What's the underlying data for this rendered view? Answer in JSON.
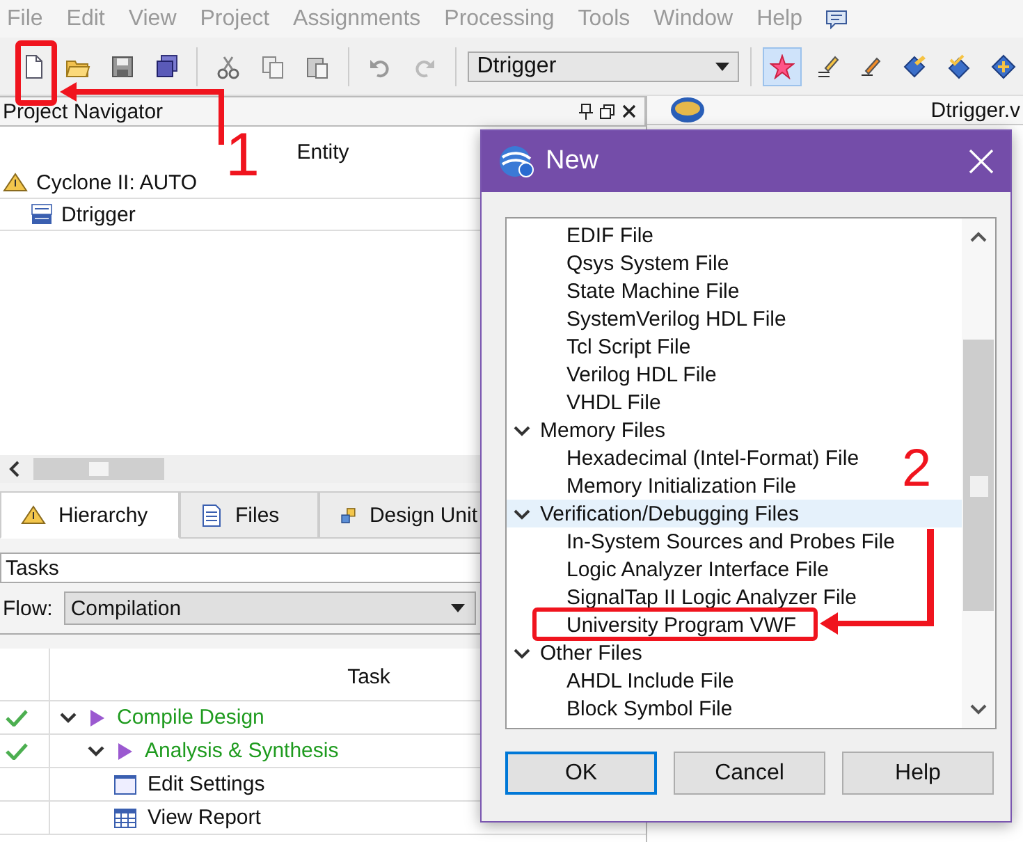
{
  "menu": [
    "File",
    "Edit",
    "View",
    "Project",
    "Assignments",
    "Processing",
    "Tools",
    "Window",
    "Help"
  ],
  "toolbar": {
    "entity_dropdown": "Dtrigger"
  },
  "project_navigator": {
    "title": "Project Navigator",
    "column": "Entity",
    "tree": [
      {
        "label": "Cyclone II: AUTO",
        "kind": "device",
        "children": [
          {
            "label": "Dtrigger",
            "kind": "entity"
          }
        ]
      }
    ]
  },
  "tabs": [
    {
      "label": "Hierarchy",
      "selected": true
    },
    {
      "label": "Files",
      "selected": false
    },
    {
      "label": "Design Unit",
      "selected": false
    }
  ],
  "tasks": {
    "title": "Tasks",
    "flow_label": "Flow:",
    "flow": "Compilation",
    "column": "Task",
    "rows": [
      {
        "label": "Compile Design",
        "kind": "flow",
        "completed": true,
        "expanded": true,
        "children": [
          {
            "label": "Analysis & Synthesis",
            "kind": "flow",
            "completed": true,
            "expanded": true,
            "children": [
              {
                "label": "Edit Settings",
                "kind": "settings",
                "completed": false
              },
              {
                "label": "View Report",
                "kind": "report",
                "completed": false
              }
            ]
          }
        ]
      }
    ]
  },
  "editor": {
    "tab": "Dtrigger.v"
  },
  "dialog": {
    "title": "New",
    "orphan_items": [
      {
        "label": "EDIF File",
        "selected": false
      },
      {
        "label": "Qsys System File",
        "selected": false
      },
      {
        "label": "State Machine File",
        "selected": false
      },
      {
        "label": "SystemVerilog HDL File",
        "selected": false
      },
      {
        "label": "Tcl Script File",
        "selected": false
      },
      {
        "label": "Verilog HDL File",
        "selected": false
      },
      {
        "label": "VHDL File",
        "selected": false
      }
    ],
    "groups": [
      {
        "label": "Memory Files",
        "expanded": true,
        "selected": false,
        "children": [
          {
            "label": "Hexadecimal (Intel-Format) File",
            "selected": false
          },
          {
            "label": "Memory Initialization File",
            "selected": false
          }
        ]
      },
      {
        "label": "Verification/Debugging Files",
        "expanded": true,
        "selected": true,
        "children": [
          {
            "label": "In-System Sources and Probes File",
            "selected": false
          },
          {
            "label": "Logic Analyzer Interface File",
            "selected": false
          },
          {
            "label": "SignalTap II Logic Analyzer File",
            "selected": false
          },
          {
            "label": "University Program VWF",
            "selected": false
          }
        ]
      },
      {
        "label": "Other Files",
        "expanded": true,
        "selected": false,
        "children": [
          {
            "label": "AHDL Include File",
            "selected": false
          },
          {
            "label": "Block Symbol File",
            "selected": false
          }
        ]
      }
    ],
    "buttons": [
      {
        "label": "OK",
        "default": true
      },
      {
        "label": "Cancel",
        "default": false
      },
      {
        "label": "Help",
        "default": false
      }
    ]
  },
  "annotations": [
    "1",
    "2"
  ]
}
